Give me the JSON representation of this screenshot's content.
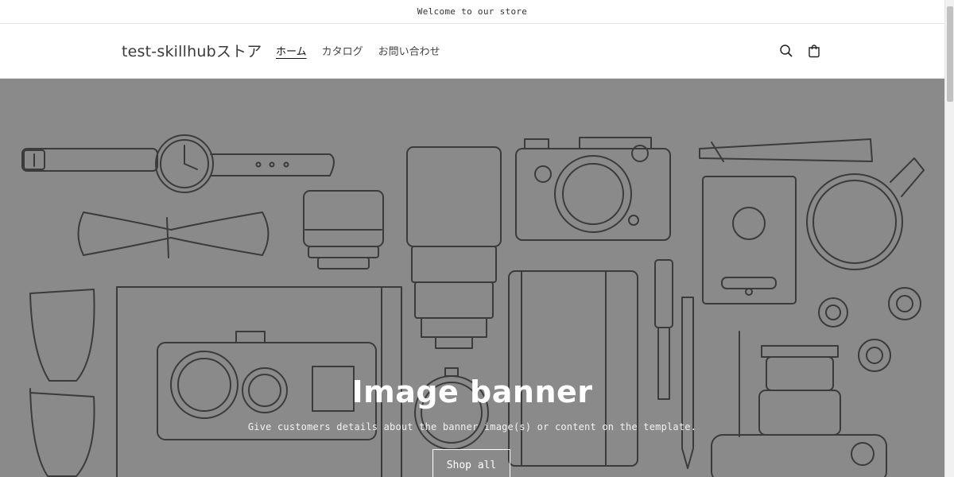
{
  "announcement": {
    "text": "Welcome to our store"
  },
  "header": {
    "logo": "test-skillhubストア",
    "nav": [
      {
        "label": "ホーム",
        "active": true
      },
      {
        "label": "カタログ",
        "active": false
      },
      {
        "label": "お問い合わせ",
        "active": false
      }
    ],
    "icons": [
      "search-icon",
      "cart-icon"
    ]
  },
  "banner": {
    "heading": "Image banner",
    "subheading": "Give customers details about the banner image(s) or content on the template.",
    "button_label": "Shop all",
    "background_color": "#8a8a8a"
  },
  "colors": {
    "text": "#121212",
    "banner_text": "#ffffff"
  }
}
